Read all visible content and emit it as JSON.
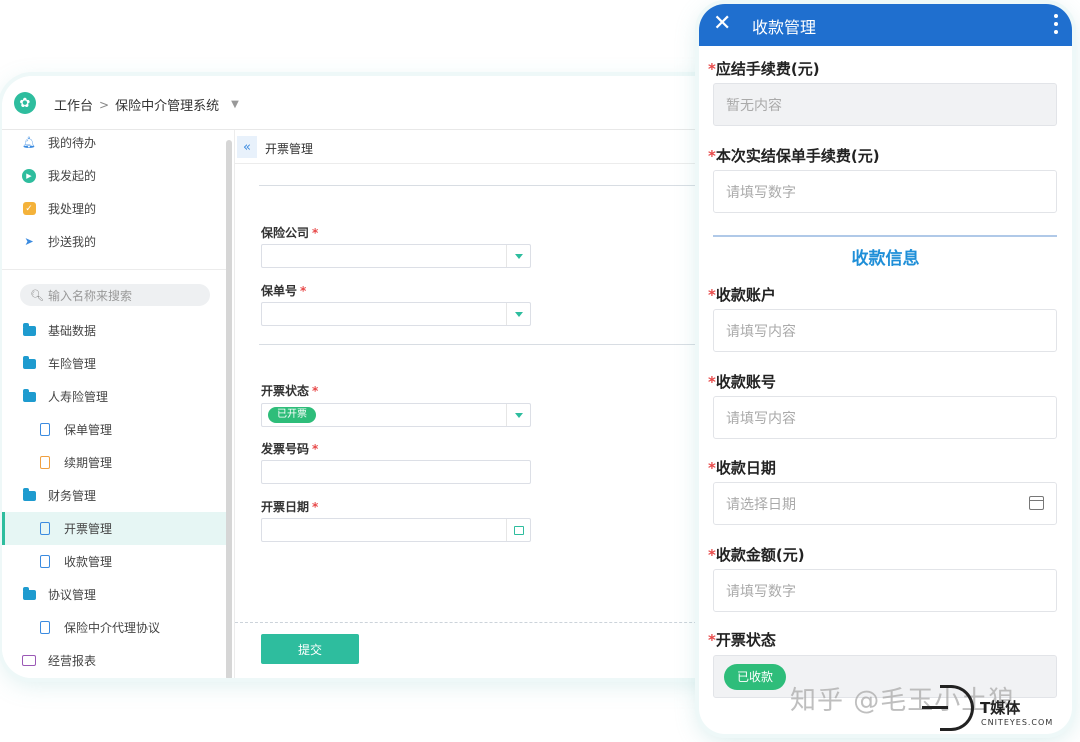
{
  "desktop": {
    "breadcrumb": {
      "home": "工作台",
      "separator": ">",
      "system": "保险中介管理系统"
    },
    "sidebar": {
      "top_items": [
        {
          "label": "我的待办",
          "icon": "bell-icon"
        },
        {
          "label": "我发起的",
          "icon": "play-circle-icon"
        },
        {
          "label": "我处理的",
          "icon": "check-box-icon"
        },
        {
          "label": "抄送我的",
          "icon": "paper-plane-icon"
        }
      ],
      "search_placeholder": "输入名称来搜索",
      "menu": [
        {
          "label": "基础数据",
          "level": 1,
          "icon": "folder-icon"
        },
        {
          "label": "车险管理",
          "level": 1,
          "icon": "folder-icon"
        },
        {
          "label": "人寿险管理",
          "level": 1,
          "icon": "folder-open-icon"
        },
        {
          "label": "保单管理",
          "level": 2,
          "icon": "document-icon"
        },
        {
          "label": "续期管理",
          "level": 2,
          "icon": "document-icon"
        },
        {
          "label": "财务管理",
          "level": 1,
          "icon": "folder-open-icon"
        },
        {
          "label": "开票管理",
          "level": 2,
          "icon": "document-icon",
          "active": true
        },
        {
          "label": "收款管理",
          "level": 2,
          "icon": "document-icon"
        },
        {
          "label": "协议管理",
          "level": 1,
          "icon": "folder-open-icon"
        },
        {
          "label": "保险中介代理协议",
          "level": 2,
          "icon": "document-icon"
        },
        {
          "label": "经营报表",
          "level": 1,
          "icon": "monitor-icon"
        }
      ]
    },
    "tab_title": "开票管理",
    "form": {
      "insurance_company_label": "保险公司",
      "policy_no_label": "保单号",
      "invoice_status_label": "开票状态",
      "invoice_status_value": "已开票",
      "invoice_number_label": "发票号码",
      "invoice_date_label": "开票日期",
      "required_mark": "*"
    },
    "submit_label": "提交"
  },
  "mobile": {
    "title": "收款管理",
    "required_mark": "*",
    "fields": {
      "fee_due_label": "应结手续费(元)",
      "fee_due_value": "暂无内容",
      "fee_actual_label": "本次实结保单手续费(元)",
      "fee_actual_placeholder": "请填写数字",
      "section_title": "收款信息",
      "account_label": "收款账户",
      "account_placeholder": "请填写内容",
      "account_no_label": "收款账号",
      "account_no_placeholder": "请填写内容",
      "date_label": "收款日期",
      "date_placeholder": "请选择日期",
      "amount_label": "收款金额(元)",
      "amount_placeholder": "请填写数字",
      "status_label": "开票状态",
      "status_value": "已收款"
    }
  },
  "watermark": {
    "zhihu": "知乎 @毛玉小土狼",
    "brand": "T媒体",
    "site": "CNITEYES.COM"
  },
  "colors": {
    "accent": "#2ebd9e",
    "mobile_header": "#1f6fcf",
    "section_title": "#1f8fd8",
    "tag_green": "#2ebd7a",
    "required": "#e84a4a"
  }
}
